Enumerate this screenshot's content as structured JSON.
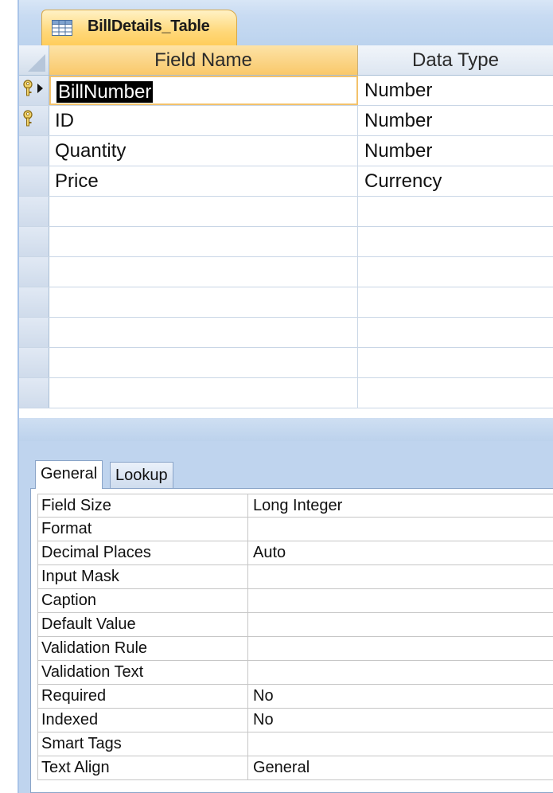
{
  "document_tab": {
    "label": "BillDetails_Table",
    "icon": "table-icon"
  },
  "grid": {
    "headers": {
      "field_name": "Field Name",
      "data_type": "Data Type"
    },
    "rows": [
      {
        "field_name": "BillNumber",
        "data_type": "Number",
        "primary_key": true,
        "current": true
      },
      {
        "field_name": "ID",
        "data_type": "Number",
        "primary_key": true,
        "current": false
      },
      {
        "field_name": "Quantity",
        "data_type": "Number",
        "primary_key": false,
        "current": false
      },
      {
        "field_name": "Price",
        "data_type": "Currency",
        "primary_key": false,
        "current": false
      }
    ],
    "empty_rows": 7
  },
  "field_properties": {
    "tabs": [
      {
        "label": "General",
        "active": true
      },
      {
        "label": "Lookup",
        "active": false
      }
    ],
    "properties": [
      {
        "name": "Field Size",
        "value": "Long Integer"
      },
      {
        "name": "Format",
        "value": ""
      },
      {
        "name": "Decimal Places",
        "value": "Auto"
      },
      {
        "name": "Input Mask",
        "value": ""
      },
      {
        "name": "Caption",
        "value": ""
      },
      {
        "name": "Default Value",
        "value": ""
      },
      {
        "name": "Validation Rule",
        "value": ""
      },
      {
        "name": "Validation Text",
        "value": ""
      },
      {
        "name": "Required",
        "value": "No"
      },
      {
        "name": "Indexed",
        "value": "No"
      },
      {
        "name": "Smart Tags",
        "value": ""
      },
      {
        "name": "Text Align",
        "value": "General"
      }
    ]
  },
  "colors": {
    "tab_active": "#ffd87a",
    "header_active": "#f9c86a",
    "pane_bg": "#bfd4ee",
    "selection": "#000000"
  }
}
